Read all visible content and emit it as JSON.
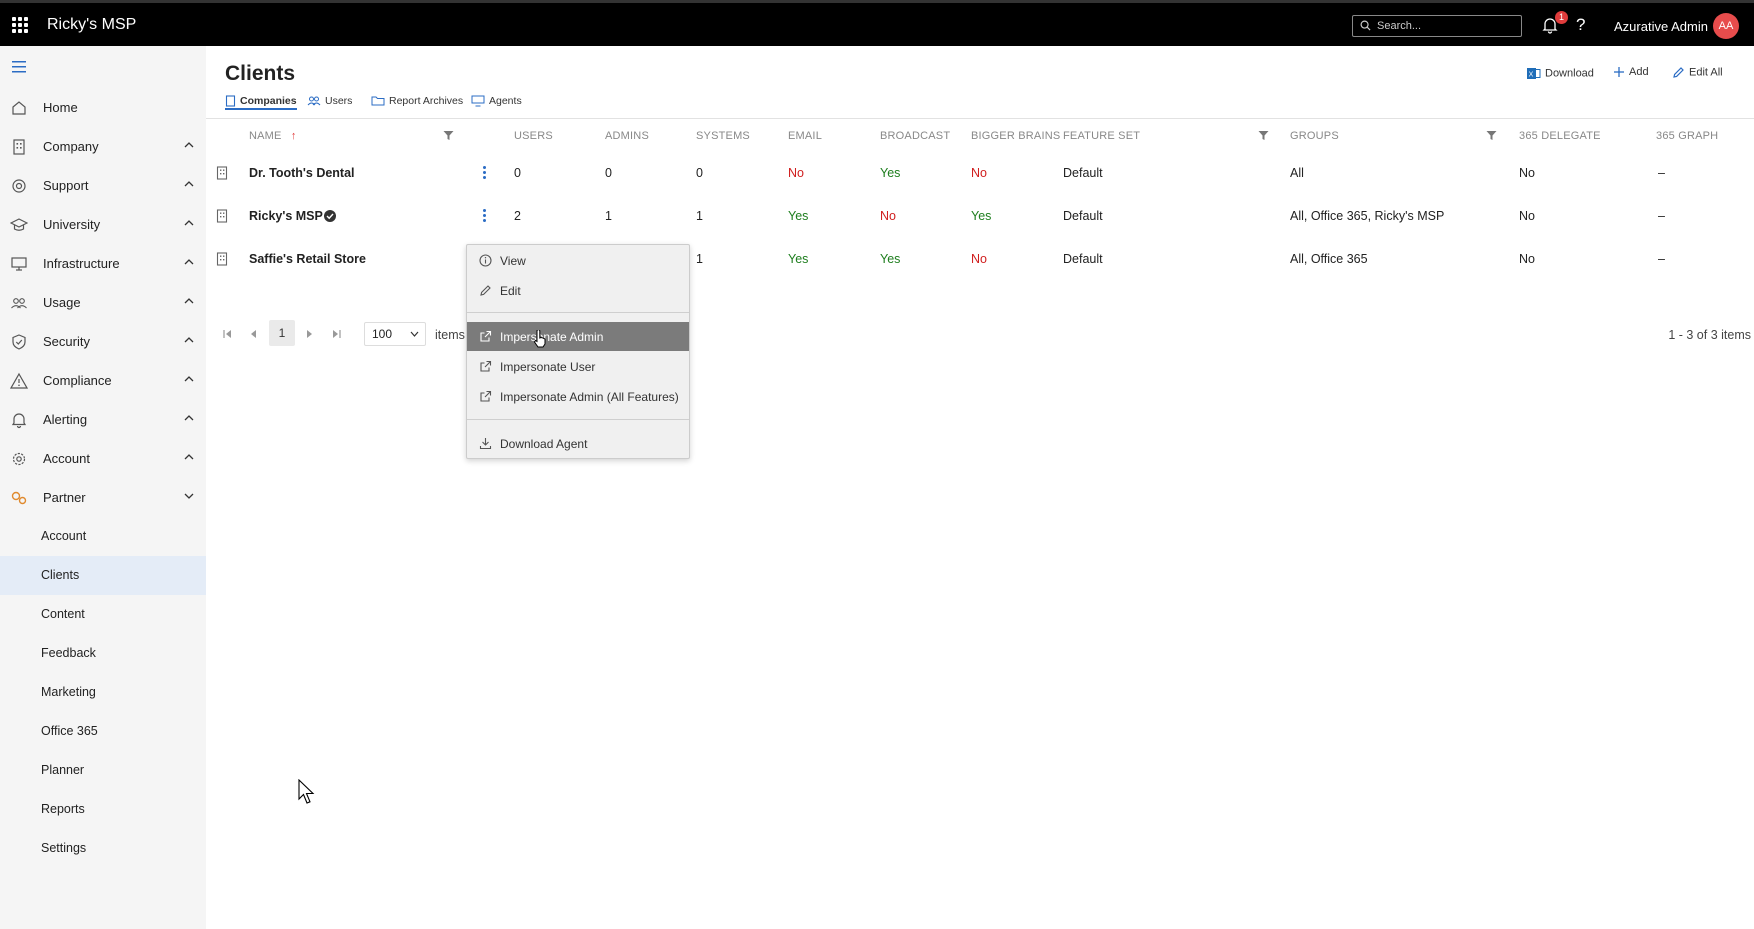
{
  "topbar": {
    "app_title": "Ricky's MSP",
    "search_placeholder": "Search...",
    "notification_count": "1",
    "help_label": "?",
    "user_name": "Azurative Admin",
    "user_initials": "AA"
  },
  "sidebar": {
    "items": [
      {
        "label": "Home",
        "icon": "home-icon"
      },
      {
        "label": "Company",
        "icon": "building-icon"
      },
      {
        "label": "Support",
        "icon": "support-icon"
      },
      {
        "label": "University",
        "icon": "graduation-cap-icon"
      },
      {
        "label": "Infrastructure",
        "icon": "monitor-icon"
      },
      {
        "label": "Usage",
        "icon": "people-icon"
      },
      {
        "label": "Security",
        "icon": "shield-icon"
      },
      {
        "label": "Compliance",
        "icon": "warning-icon"
      },
      {
        "label": "Alerting",
        "icon": "bell-icon"
      },
      {
        "label": "Account",
        "icon": "gear-icon"
      },
      {
        "label": "Partner",
        "icon": "partner-icon"
      }
    ],
    "sub_items": [
      "Account",
      "Clients",
      "Content",
      "Feedback",
      "Marketing",
      "Office 365",
      "Planner",
      "Reports",
      "Settings"
    ],
    "active_sub_item": "Clients"
  },
  "main": {
    "title": "Clients",
    "tabs": [
      "Companies",
      "Users",
      "Report Archives",
      "Agents"
    ],
    "active_tab": "Companies",
    "actions": {
      "download": "Download",
      "add": "Add",
      "edit_all": "Edit All"
    },
    "table": {
      "columns": [
        "NAME",
        "USERS",
        "ADMINS",
        "SYSTEMS",
        "EMAIL",
        "BROADCAST",
        "BIGGER BRAINS",
        "FEATURE SET",
        "GROUPS",
        "365 DELEGATE",
        "365 GRAPH"
      ],
      "sort_indicator": "↑",
      "rows": [
        {
          "name": "Dr. Tooth's Dental",
          "users": "0",
          "admins": "0",
          "systems": "0",
          "email": "No",
          "broadcast": "Yes",
          "bigger_brains": "No",
          "feature_set": "Default",
          "groups": "All",
          "delegate": "No",
          "graph": "–"
        },
        {
          "name": "Ricky's MSP",
          "users": "2",
          "admins": "1",
          "systems": "1",
          "email": "Yes",
          "broadcast": "No",
          "bigger_brains": "Yes",
          "feature_set": "Default",
          "groups": "All, Office 365, Ricky's MSP",
          "delegate": "No",
          "graph": "–"
        },
        {
          "name": "Saffie's Retail Store",
          "users": "",
          "admins": "",
          "systems": "1",
          "email": "Yes",
          "broadcast": "Yes",
          "bigger_brains": "No",
          "feature_set": "Default",
          "groups": "All, Office 365",
          "delegate": "No",
          "graph": "–"
        }
      ]
    },
    "pagination": {
      "current_page": "1",
      "page_size": "100",
      "items_label": "items",
      "count_label": "1 - 3 of 3 items"
    }
  },
  "context_menu": {
    "items": [
      {
        "label": "View",
        "icon": "info-icon"
      },
      {
        "label": "Edit",
        "icon": "pencil-icon"
      },
      {
        "label": "Impersonate Admin",
        "icon": "external-link-icon",
        "highlighted": true
      },
      {
        "label": "Impersonate User",
        "icon": "external-link-icon"
      },
      {
        "label": "Impersonate Admin (All Features)",
        "icon": "external-link-icon"
      },
      {
        "label": "Download Agent",
        "icon": "download-icon"
      }
    ]
  },
  "colors": {
    "topbar_bg": "#000000",
    "accent": "#2b6cc4",
    "yes": "#1e7e1e",
    "no": "#d01e1e",
    "avatar": "#e74c4c",
    "active_nav": "#e4ecf7",
    "menu_highlight": "#7b7b7b"
  }
}
